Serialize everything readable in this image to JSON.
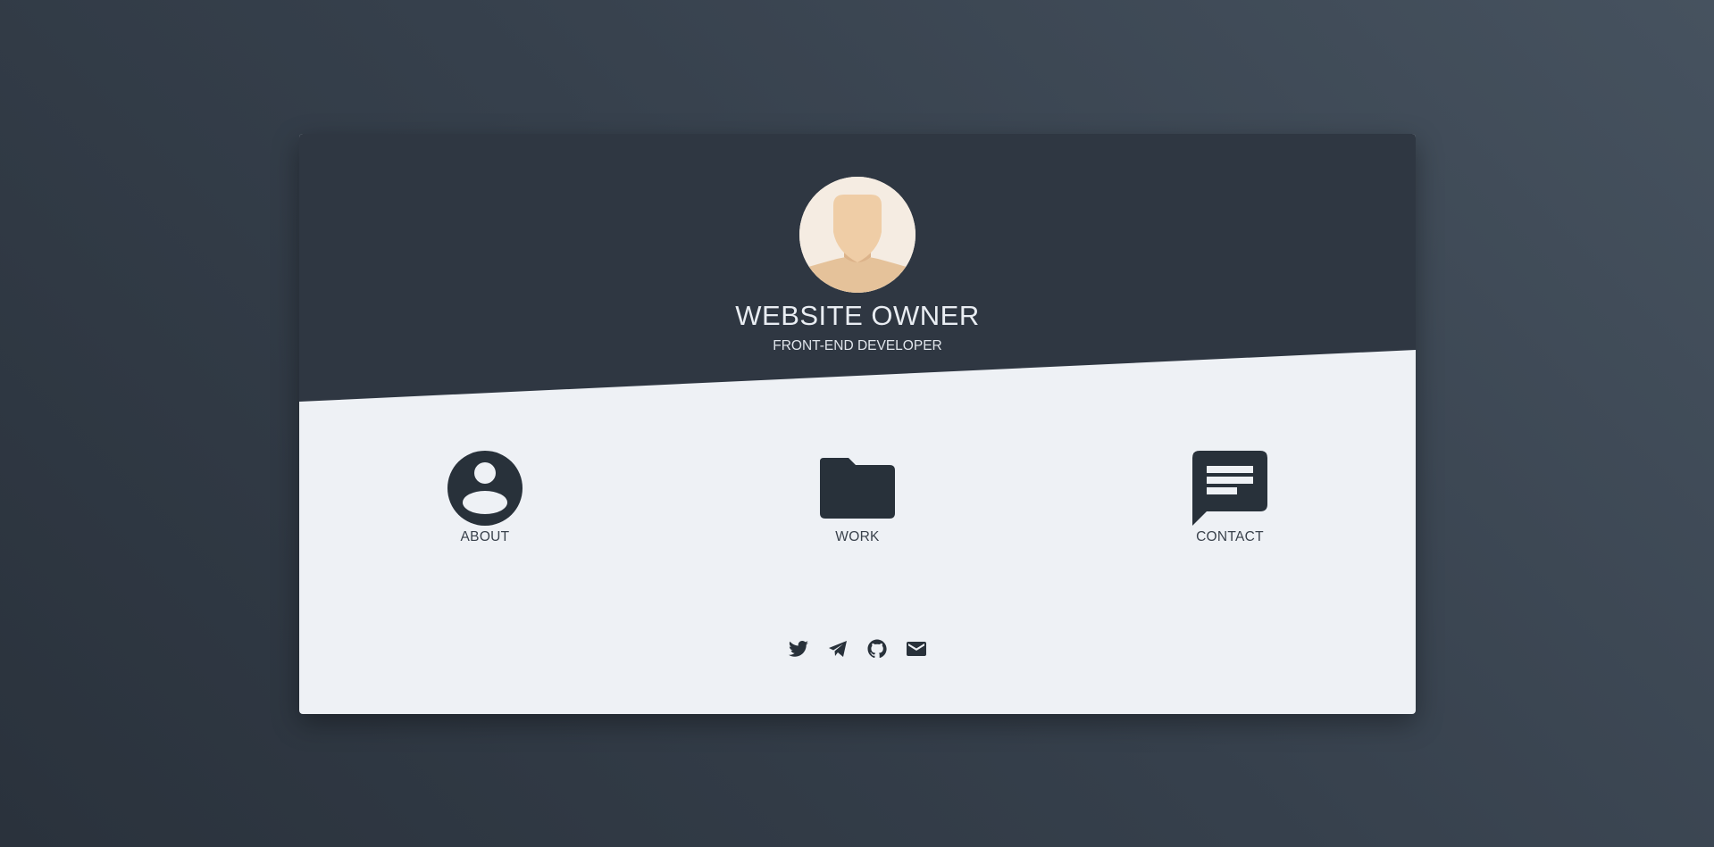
{
  "profile": {
    "name": "WEBSITE OWNER",
    "role": "FRONT-END DEVELOPER",
    "avatar_icon": "person-avatar-icon"
  },
  "nav": {
    "items": [
      {
        "label": "ABOUT",
        "icon": "account-circle-icon"
      },
      {
        "label": "WORK",
        "icon": "folder-icon"
      },
      {
        "label": "CONTACT",
        "icon": "message-icon"
      }
    ]
  },
  "social": [
    {
      "icon": "twitter-icon"
    },
    {
      "icon": "telegram-icon"
    },
    {
      "icon": "github-icon"
    },
    {
      "icon": "email-icon"
    }
  ],
  "colors": {
    "header_bg": "#2f3742",
    "body_bg": "#eef1f5",
    "icon_dark": "#28313a",
    "header_text": "#e9edf2"
  }
}
